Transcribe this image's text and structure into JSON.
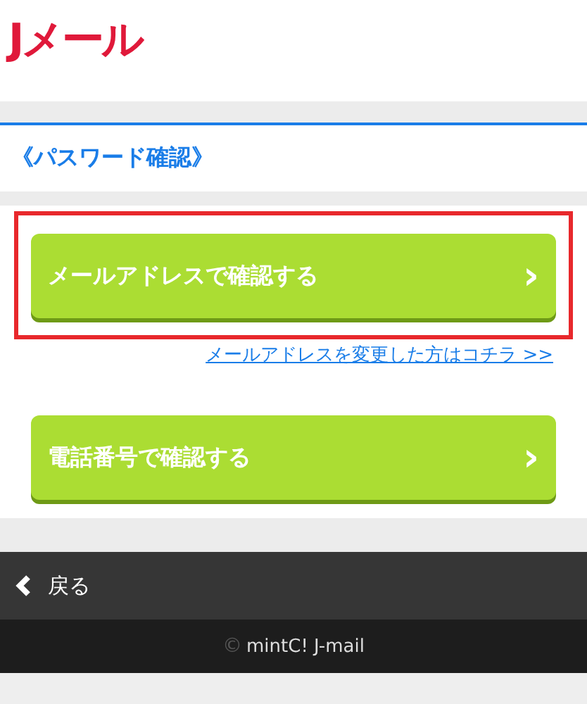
{
  "header": {
    "logo": "Jメール"
  },
  "page_title": "《パスワード確認》",
  "options": [
    {
      "label": "メールアドレスで確認する",
      "chevron": "›",
      "highlighted": true,
      "link": "メールアドレスを変更した方はコチラ >>"
    },
    {
      "label": "電話番号で確認する",
      "chevron": "›",
      "highlighted": false
    }
  ],
  "back_bar": {
    "label": "戻る"
  },
  "footer": {
    "copyright_mark": "©",
    "text": "mintC! J-mail"
  }
}
